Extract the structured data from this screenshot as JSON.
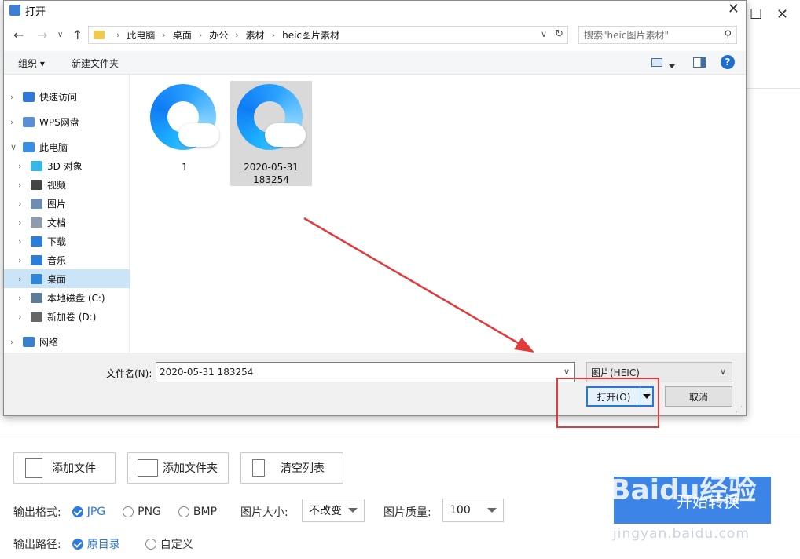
{
  "dialog": {
    "title": "打开",
    "close": "✕",
    "breadcrumbs": [
      "此电脑",
      "桌面",
      "办公",
      "素材",
      "heic图片素材"
    ],
    "search_placeholder": "搜索\"heic图片素材\"",
    "toolbar": {
      "organize": "组织 ▾",
      "new_folder": "新建文件夹",
      "help": "?"
    },
    "sidebar": [
      {
        "label": "快速访问",
        "icon": "star-icon",
        "color": "#2f7ad8"
      },
      {
        "label": "WPS网盘",
        "icon": "cloud-icon",
        "color": "#5a8fd8"
      },
      {
        "label": "此电脑",
        "icon": "computer-icon",
        "color": "#3a8ee6"
      },
      {
        "label": "3D 对象",
        "icon": "cube-icon",
        "color": "#38b6e8"
      },
      {
        "label": "视频",
        "icon": "film-icon",
        "color": "#444444"
      },
      {
        "label": "图片",
        "icon": "picture-icon",
        "color": "#6e8db3"
      },
      {
        "label": "文档",
        "icon": "document-icon",
        "color": "#8c9cad"
      },
      {
        "label": "下载",
        "icon": "download-icon",
        "color": "#2c7fd8"
      },
      {
        "label": "音乐",
        "icon": "music-icon",
        "color": "#2c7fd8"
      },
      {
        "label": "桌面",
        "icon": "desktop-icon",
        "color": "#2f86d9"
      },
      {
        "label": "本地磁盘 (C:)",
        "icon": "drive-c-icon",
        "color": "#5e7b9a"
      },
      {
        "label": "新加卷 (D:)",
        "icon": "drive-d-icon",
        "color": "#666666"
      },
      {
        "label": "网络",
        "icon": "network-icon",
        "color": "#3a7fd0"
      }
    ],
    "files": [
      {
        "name": "1",
        "selected": false
      },
      {
        "name": "2020-05-31 183254",
        "selected": true
      }
    ],
    "filename_label": "文件名(N):",
    "filename_value": "2020-05-31 183254",
    "filetype": "图片(HEIC)",
    "open_label": "打开(O)",
    "cancel_label": "取消"
  },
  "app": {
    "add_file": "添加文件",
    "add_folder": "添加文件夹",
    "clear_list": "清空列表",
    "output_format_label": "输出格式:",
    "formats": [
      "JPG",
      "PNG",
      "BMP"
    ],
    "selected_format": "JPG",
    "size_label": "图片大小:",
    "size_value": "不改变",
    "quality_label": "图片质量:",
    "quality_value": "100",
    "output_path_label": "输出路径:",
    "path_options": [
      "原目录",
      "自定义"
    ],
    "selected_path": "原目录",
    "start_label": "开始转换",
    "accent": "#3c84e6"
  },
  "watermark": {
    "brand": "Baidu经验",
    "url": "jingyan.baidu.com"
  }
}
